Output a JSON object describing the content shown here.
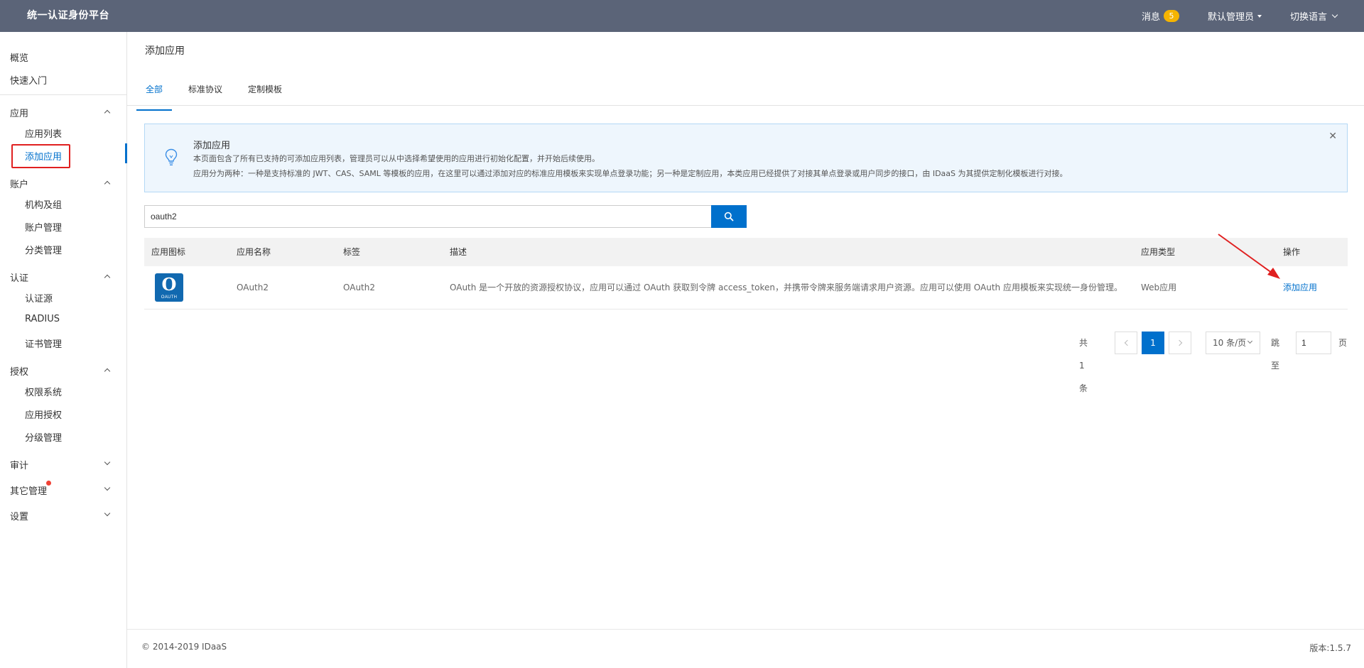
{
  "topbar": {
    "brand": "统一认证身份平台",
    "messages_label": "消息",
    "messages_count": "5",
    "user_label": "默认管理员",
    "language_label": "切换语言"
  },
  "sidebar": {
    "overview": "概览",
    "quickstart": "快速入门",
    "groups": [
      {
        "label": "应用",
        "expanded": true,
        "items": [
          "应用列表",
          "添加应用"
        ]
      },
      {
        "label": "账户",
        "expanded": true,
        "items": [
          "机构及组",
          "账户管理",
          "分类管理"
        ]
      },
      {
        "label": "认证",
        "expanded": true,
        "items": [
          "认证源",
          "RADIUS",
          "证书管理"
        ]
      },
      {
        "label": "授权",
        "expanded": true,
        "items": [
          "权限系统",
          "应用授权",
          "分级管理"
        ]
      },
      {
        "label": "审计",
        "expanded": false,
        "items": []
      },
      {
        "label": "其它管理",
        "expanded": false,
        "items": []
      },
      {
        "label": "设置",
        "expanded": false,
        "items": []
      }
    ],
    "active_item": "添加应用"
  },
  "main": {
    "title": "添加应用",
    "tabs": [
      {
        "label": "全部",
        "active": true
      },
      {
        "label": "标准协议",
        "active": false
      },
      {
        "label": "定制模板",
        "active": false
      }
    ],
    "notice": {
      "title": "添加应用",
      "line1": "本页面包含了所有已支持的可添加应用列表，管理员可以从中选择希望使用的应用进行初始化配置，并开始后续使用。",
      "line2": "应用分为两种：一种是支持标准的 JWT、CAS、SAML 等模板的应用，在这里可以通过添加对应的标准应用模板来实现单点登录功能；另一种是定制应用，本类应用已经提供了对接其单点登录或用户同步的接口，由 IDaaS 为其提供定制化模板进行对接。"
    },
    "search": {
      "value": "oauth2"
    },
    "table": {
      "headers": [
        "应用图标",
        "应用名称",
        "标签",
        "描述",
        "应用类型",
        "操作"
      ],
      "rows": [
        {
          "icon_letter": "O",
          "icon_text": "OAUTH",
          "name": "OAuth2",
          "tag": "OAuth2",
          "description": "OAuth 是一个开放的资源授权协议，应用可以通过 OAuth 获取到令牌 access_token，并携带令牌来服务端请求用户资源。应用可以使用 OAuth 应用模板来实现统一身份管理。",
          "type": "Web应用",
          "action": "添加应用"
        }
      ]
    },
    "pagination": {
      "total_label": "共 1 条",
      "current_page": "1",
      "page_size": "10 条/页",
      "jump_label": "跳至",
      "jump_value": "1",
      "page_suffix": "页"
    }
  },
  "footer": {
    "copyright": "© 2014-2019 IDaaS",
    "version": "版本:1.5.7"
  },
  "colors": {
    "topbar": "#5b6478",
    "accent": "#0070cc",
    "badge": "#f5b400",
    "highlight_red": "#e02020"
  }
}
